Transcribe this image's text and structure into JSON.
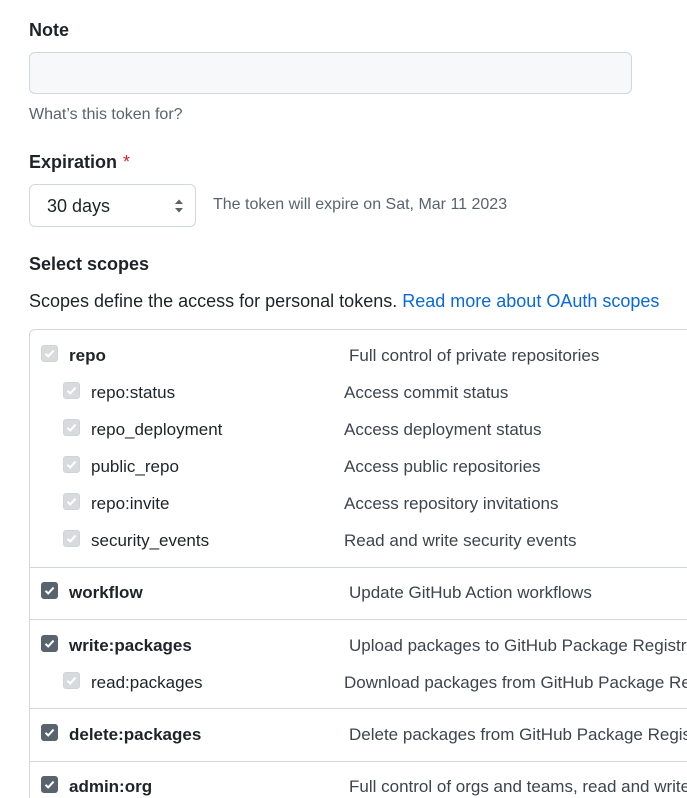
{
  "note": {
    "label": "Note",
    "value": "",
    "hint": "What’s this token for?"
  },
  "expiration": {
    "label": "Expiration",
    "required_mark": "*",
    "selected": "30 days",
    "info": "The token will expire on Sat, Mar 11 2023"
  },
  "scopes": {
    "heading": "Select scopes",
    "description": "Scopes define the access for personal tokens.",
    "link_text": "Read more about OAuth scopes",
    "rows": [
      {
        "name": "repo",
        "desc": "Full control of private repositories",
        "checked": true,
        "disabled": true,
        "sub": false
      },
      {
        "name": "repo:status",
        "desc": "Access commit status",
        "checked": true,
        "disabled": true,
        "sub": true
      },
      {
        "name": "repo_deployment",
        "desc": "Access deployment status",
        "checked": true,
        "disabled": true,
        "sub": true
      },
      {
        "name": "public_repo",
        "desc": "Access public repositories",
        "checked": true,
        "disabled": true,
        "sub": true
      },
      {
        "name": "repo:invite",
        "desc": "Access repository invitations",
        "checked": true,
        "disabled": true,
        "sub": true
      },
      {
        "name": "security_events",
        "desc": "Read and write security events",
        "checked": true,
        "disabled": true,
        "sub": true
      },
      {
        "name": "workflow",
        "desc": "Update GitHub Action workflows",
        "checked": true,
        "disabled": false,
        "sub": false
      },
      {
        "name": "write:packages",
        "desc": "Upload packages to GitHub Package Registry",
        "checked": true,
        "disabled": false,
        "sub": false
      },
      {
        "name": "read:packages",
        "desc": "Download packages from GitHub Package Regis",
        "checked": true,
        "disabled": true,
        "sub": true
      },
      {
        "name": "delete:packages",
        "desc": "Delete packages from GitHub Package Registry",
        "checked": true,
        "disabled": false,
        "sub": false
      },
      {
        "name": "admin:org",
        "desc": "Full control of orgs and teams, read and write o",
        "checked": true,
        "disabled": false,
        "sub": false
      }
    ]
  },
  "colors": {
    "accent_link": "#0969da",
    "required": "#cf222e",
    "checkbox_checked": "#59636e",
    "checkbox_disabled": "#d8dbde"
  }
}
